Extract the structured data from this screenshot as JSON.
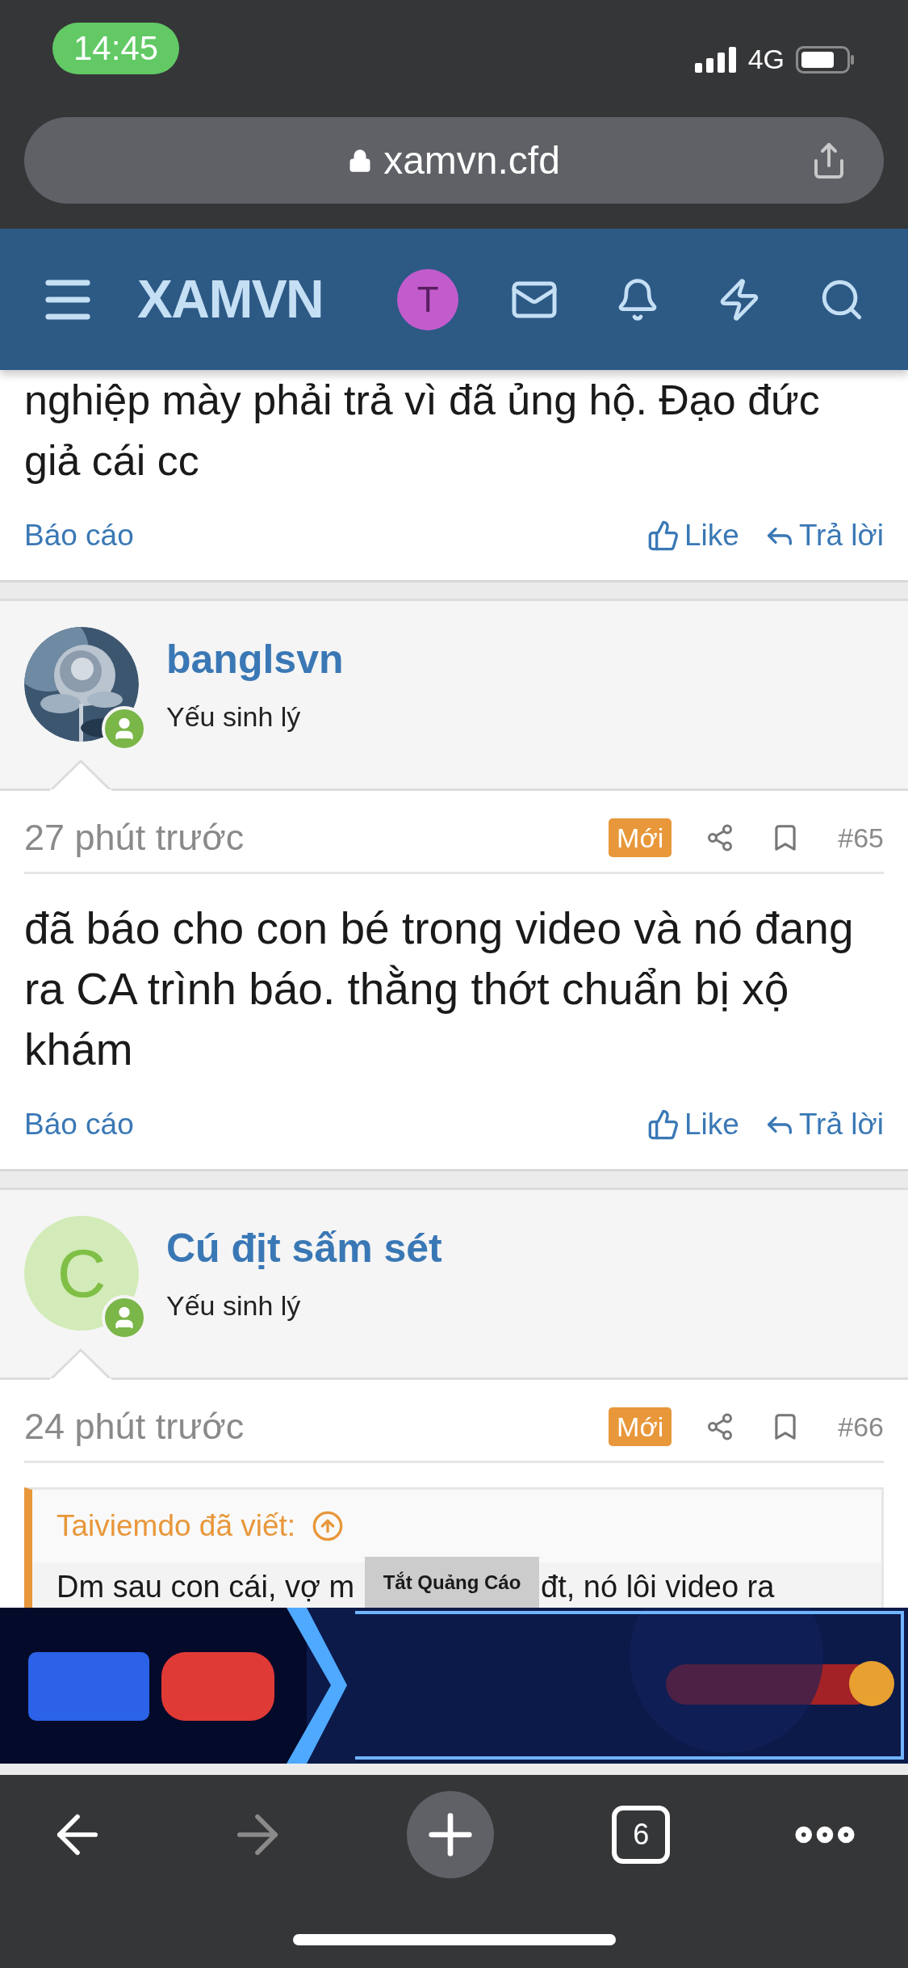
{
  "status_bar": {
    "time": "14:45",
    "network": "4G"
  },
  "browser": {
    "url": "xamvn.cfd",
    "tab_count": "6"
  },
  "site_header": {
    "logo": "XAMVN",
    "avatar_letter": "T"
  },
  "posts": [
    {
      "kind": "tail",
      "body_lines": [
        "nghiệp mày phải trả vì đã ủng hộ. Đạo đức",
        "giả cái cc"
      ],
      "actions": {
        "report": "Báo cáo",
        "like": "Like",
        "reply": "Trả lời"
      }
    },
    {
      "kind": "full",
      "author": {
        "name": "banglsvn",
        "title": "Yếu sinh lý"
      },
      "time": "27 phút trước",
      "badge": "Mới",
      "number": "#65",
      "body": "đã báo cho con bé trong video và nó đang ra CA trình báo. thằng thớt chuẩn bị xộ khám",
      "actions": {
        "report": "Báo cáo",
        "like": "Like",
        "reply": "Trả lời"
      }
    },
    {
      "kind": "full",
      "author": {
        "name": "Cú địt sấm sét",
        "title": "Yếu sinh lý",
        "avatar": {
          "kind": "letter",
          "letter": "C"
        }
      },
      "time": "24 phút trước",
      "badge": "Mới",
      "number": "#66",
      "quote": {
        "author_line": "Taiviemdo đã viết:",
        "text_left": "Dm sau con cái, vợ m",
        "text_right": "đt, nó lôi video ra"
      }
    }
  ],
  "ad": {
    "close_label": "Tắt Quảng Cáo"
  }
}
